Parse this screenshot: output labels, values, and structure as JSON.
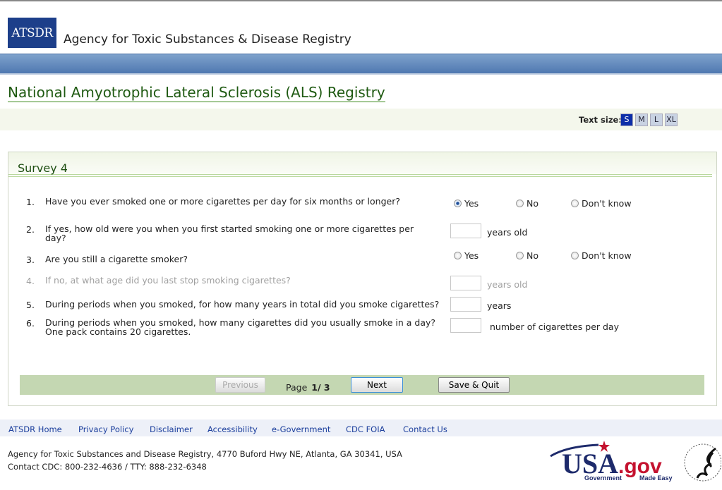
{
  "header": {
    "logo": "ATSDR",
    "agency": "Agency for Toxic Substances & Disease Registry",
    "title": "National Amyotrophic Lateral Sclerosis (ALS) Registry"
  },
  "text_size": {
    "label": "Text size:",
    "options": [
      "S",
      "M",
      "L",
      "XL"
    ],
    "selected": "S"
  },
  "survey": {
    "title": "Survey 4",
    "questions": [
      {
        "num": "1.",
        "text": "Have you ever smoked one or more cigarettes per day for six months or longer?",
        "options": [
          "Yes",
          "No",
          "Don't know"
        ],
        "selected": "Yes"
      },
      {
        "num": "2.",
        "text": "If yes, how old were you when you first started smoking one or more cigarettes per day?",
        "value": "",
        "unit": "years old"
      },
      {
        "num": "3.",
        "text": "Are you still a cigarette smoker?",
        "options": [
          "Yes",
          "No",
          "Don't know"
        ],
        "selected": ""
      },
      {
        "num": "4.",
        "text": "If no, at what age did you last stop smoking cigarettes?",
        "value": "",
        "unit": "years old",
        "disabled": true
      },
      {
        "num": "5.",
        "text": "During periods when you smoked, for how many years in total did you smoke cigarettes?",
        "value": "",
        "unit": "years"
      },
      {
        "num": "6.",
        "text": "During periods when you smoked, how many cigarettes did you usually smoke in a day? One pack contains 20 cigarettes.",
        "value": "",
        "unit": "number of cigarettes per day"
      }
    ]
  },
  "nav": {
    "previous": "Previous",
    "page_label": "Page",
    "page": "1/ 3",
    "next": "Next",
    "save_quit": "Save & Quit"
  },
  "footer": {
    "links": [
      "ATSDR Home",
      "Privacy Policy",
      "Disclaimer",
      "Accessibility",
      "e-Government",
      "CDC FOIA",
      "Contact Us"
    ],
    "address": "Agency for Toxic Substances and Disease Registry, 4770 Buford Hwy NE, Atlanta, GA 30341, USA",
    "contact": "Contact CDC: 800-232-4636 / TTY: 888-232-6348",
    "usagov_logo": "USA.gov Government Made Easy",
    "hhs_logo": "HHS seal"
  },
  "colors": {
    "title_green": "#1f5a12",
    "blue_bar": "#4f78b0",
    "nav_bar": "#c4d7b2",
    "link": "#1b3e9c"
  }
}
